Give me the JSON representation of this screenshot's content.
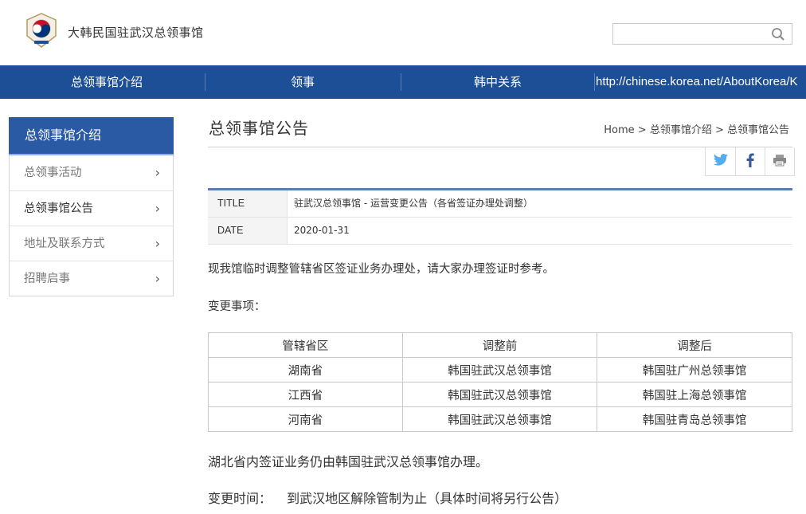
{
  "header": {
    "site_title": "大韩民国驻武汉总领事馆",
    "search_placeholder": ""
  },
  "nav": {
    "items": [
      "总领事馆介绍",
      "领事",
      "韩中关系"
    ],
    "url_text": "http://chinese.korea.net/AboutKorea/K"
  },
  "sidebar": {
    "heading": "总领事馆介绍",
    "items": [
      {
        "label": "总领事活动",
        "active": false
      },
      {
        "label": "总领事馆公告",
        "active": true
      },
      {
        "label": "地址及联系方式",
        "active": false
      },
      {
        "label": "招聘启事",
        "active": false
      }
    ]
  },
  "main": {
    "page_title": "总领事馆公告",
    "breadcrumb": "Home > 总领事馆介绍 > 总领事馆公告",
    "meta": {
      "title_label": "TITLE",
      "title_value": "驻武汉总领事馆 - 运营变更公告（各省签证办理处调整）",
      "date_label": "DATE",
      "date_value": "2020-01-31"
    },
    "intro": "现我馆临时调整管辖省区签证业务办理处，请大家办理签证时参考。",
    "changes_heading": "变更事项：",
    "table": {
      "headers": [
        "管辖省区",
        "调整前",
        "调整后"
      ],
      "rows": [
        [
          "湖南省",
          "韩国驻武汉总领事馆",
          "韩国驻广州总领事馆"
        ],
        [
          "江西省",
          "韩国驻武汉总领事馆",
          "韩国驻上海总领事馆"
        ],
        [
          "河南省",
          "韩国驻武汉总领事馆",
          "韩国驻青岛总领事馆"
        ]
      ]
    },
    "hubei_note": "湖北省内签证业务仍由韩国驻武汉总领事馆办理。",
    "change_time_label": "变更时间：",
    "change_time_value": "到武汉地区解除管制为止（具体时间将另行公告）"
  },
  "colors": {
    "nav_bg": "#1d4f96",
    "sidebar_head_bg": "#2a5aa3",
    "meta_accent": "#5a7db6",
    "twitter": "#55acee",
    "facebook": "#3b5998"
  },
  "icons": [
    "emblem-logo",
    "search-icon",
    "twitter-icon",
    "facebook-icon",
    "print-icon",
    "chevron-right-icon"
  ]
}
